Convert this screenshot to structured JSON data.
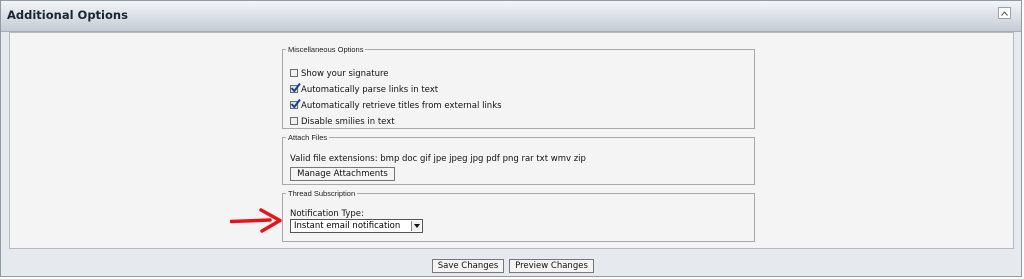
{
  "panel": {
    "title": "Additional Options",
    "collapse_icon": "collapse-icon"
  },
  "misc": {
    "legend": "Miscellaneous Options",
    "options": [
      {
        "label": "Show your signature",
        "checked": false
      },
      {
        "label": "Automatically parse links in text",
        "checked": true
      },
      {
        "label": "Automatically retrieve titles from external links",
        "checked": true
      },
      {
        "label": "Disable smilies in text",
        "checked": false
      }
    ]
  },
  "attach": {
    "legend": "Attach Files",
    "extensions_text": "Valid file extensions: bmp doc gif jpe jpeg jpg pdf png rar txt wmv zip",
    "manage_label": "Manage Attachments"
  },
  "subscription": {
    "legend": "Thread Subscription",
    "notification_label": "Notification Type:",
    "selected": "Instant email notification"
  },
  "footer": {
    "save_label": "Save Changes",
    "preview_label": "Preview Changes"
  },
  "annotation": {
    "arrow_color": "#e8141c"
  }
}
